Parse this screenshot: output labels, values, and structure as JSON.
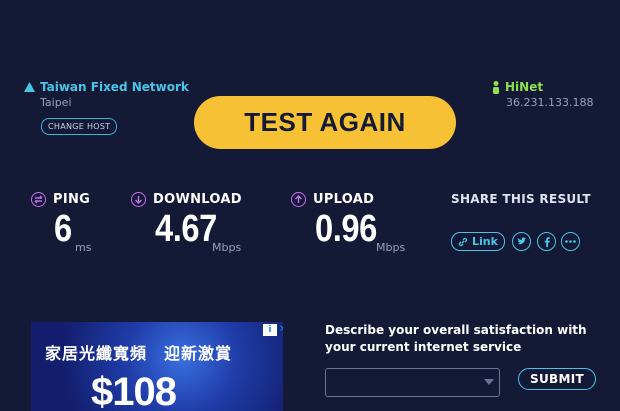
{
  "host": {
    "name": "Taiwan Fixed Network",
    "city": "Taipei",
    "change_label": "CHANGE HOST"
  },
  "isp": {
    "name": "HiNet",
    "ip": "36.231.133.188"
  },
  "test_again_label": "TEST AGAIN",
  "metrics": {
    "ping": {
      "label": "PING",
      "value": "6",
      "unit": "ms",
      "icon": "ping-icon"
    },
    "download": {
      "label": "DOWNLOAD",
      "value": "4.67",
      "unit": "Mbps",
      "icon": "download-arrow-icon"
    },
    "upload": {
      "label": "UPLOAD",
      "value": "0.96",
      "unit": "Mbps",
      "icon": "upload-arrow-icon"
    }
  },
  "share": {
    "title": "SHARE THIS RESULT",
    "link_label": "Link",
    "icons": [
      "twitter-icon",
      "facebook-icon",
      "more-icon"
    ]
  },
  "ad": {
    "line1": "家居光纖寬頻　迎新激賞",
    "price": "$108"
  },
  "survey": {
    "question": "Describe your overall satisfaction with your current internet service",
    "submit_label": "SUBMIT"
  },
  "colors": {
    "background": "#141a35",
    "accent_yellow": "#f7c136",
    "accent_cyan": "#49c5e8",
    "accent_purple": "#c46ff0",
    "isp_green": "#8fe04f"
  }
}
